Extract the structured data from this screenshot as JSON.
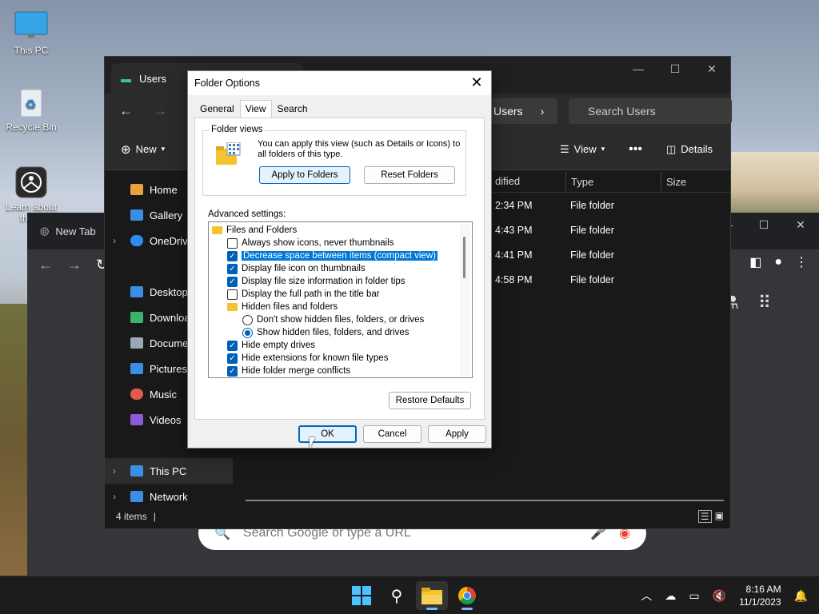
{
  "desktop": {
    "icons": [
      {
        "label": "This PC",
        "icon": "monitor-icon"
      },
      {
        "label": "Recycle Bin",
        "icon": "recycle-bin-icon"
      },
      {
        "label": "Learn about this p",
        "icon": "learn-icon"
      }
    ]
  },
  "chrome": {
    "tab_title": "New Tab",
    "search_placeholder": "Search Google or type a URL"
  },
  "explorer": {
    "tab_title": "Users",
    "breadcrumb": "Users",
    "search_placeholder": "Search Users",
    "toolbar": {
      "new_label": "New",
      "view_label": "View",
      "details_label": "Details"
    },
    "sidebar": [
      {
        "label": "Home",
        "color": "#e8a33d"
      },
      {
        "label": "Gallery",
        "color": "#3a8ee6"
      },
      {
        "label": "OneDrive",
        "color": "#2e8cf0",
        "chevron": true
      },
      {
        "label": "Desktop",
        "color": "#3a8ee6"
      },
      {
        "label": "Downloads",
        "color": "#3bb36a"
      },
      {
        "label": "Documents",
        "color": "#9aa7b5"
      },
      {
        "label": "Pictures",
        "color": "#3a8ee6"
      },
      {
        "label": "Music",
        "color": "#e05a4e"
      },
      {
        "label": "Videos",
        "color": "#8a5bd6"
      },
      {
        "label": "This PC",
        "color": "#3a8ee6",
        "chevron": true
      },
      {
        "label": "Network",
        "color": "#3a8ee6",
        "chevron": true
      }
    ],
    "columns": {
      "modified": "dified",
      "type": "Type",
      "size": "Size"
    },
    "rows": [
      {
        "modified": "2:34 PM",
        "type": "File folder"
      },
      {
        "modified": "4:43 PM",
        "type": "File folder"
      },
      {
        "modified": "4:41 PM",
        "type": "File folder"
      },
      {
        "modified": "4:58 PM",
        "type": "File folder"
      }
    ],
    "status": "4 items"
  },
  "dialog": {
    "title": "Folder Options",
    "tabs": [
      "General",
      "View",
      "Search"
    ],
    "folder_views_label": "Folder views",
    "folder_views_text": "You can apply this view (such as Details or Icons) to all folders of this type.",
    "apply_to_folders": "Apply to Folders",
    "reset_folders": "Reset Folders",
    "advanced_label": "Advanced settings:",
    "tree": [
      {
        "kind": "folder",
        "label": "Files and Folders",
        "indent": 0
      },
      {
        "kind": "check",
        "checked": false,
        "label": "Always show icons, never thumbnails",
        "indent": 1
      },
      {
        "kind": "check",
        "checked": true,
        "label": "Decrease space between items (compact view)",
        "indent": 1,
        "highlight": true
      },
      {
        "kind": "check",
        "checked": true,
        "label": "Display file icon on thumbnails",
        "indent": 1
      },
      {
        "kind": "check",
        "checked": true,
        "label": "Display file size information in folder tips",
        "indent": 1
      },
      {
        "kind": "check",
        "checked": false,
        "label": "Display the full path in the title bar",
        "indent": 1
      },
      {
        "kind": "folder",
        "label": "Hidden files and folders",
        "indent": 1
      },
      {
        "kind": "radio",
        "checked": false,
        "label": "Don't show hidden files, folders, or drives",
        "indent": 2
      },
      {
        "kind": "radio",
        "checked": true,
        "label": "Show hidden files, folders, and drives",
        "indent": 2
      },
      {
        "kind": "check",
        "checked": true,
        "label": "Hide empty drives",
        "indent": 1
      },
      {
        "kind": "check",
        "checked": true,
        "label": "Hide extensions for known file types",
        "indent": 1
      },
      {
        "kind": "check",
        "checked": true,
        "label": "Hide folder merge conflicts",
        "indent": 1
      }
    ],
    "restore_defaults": "Restore Defaults",
    "ok": "OK",
    "cancel": "Cancel",
    "apply": "Apply"
  },
  "taskbar": {
    "time": "8:16 AM",
    "date": "11/1/2023"
  }
}
